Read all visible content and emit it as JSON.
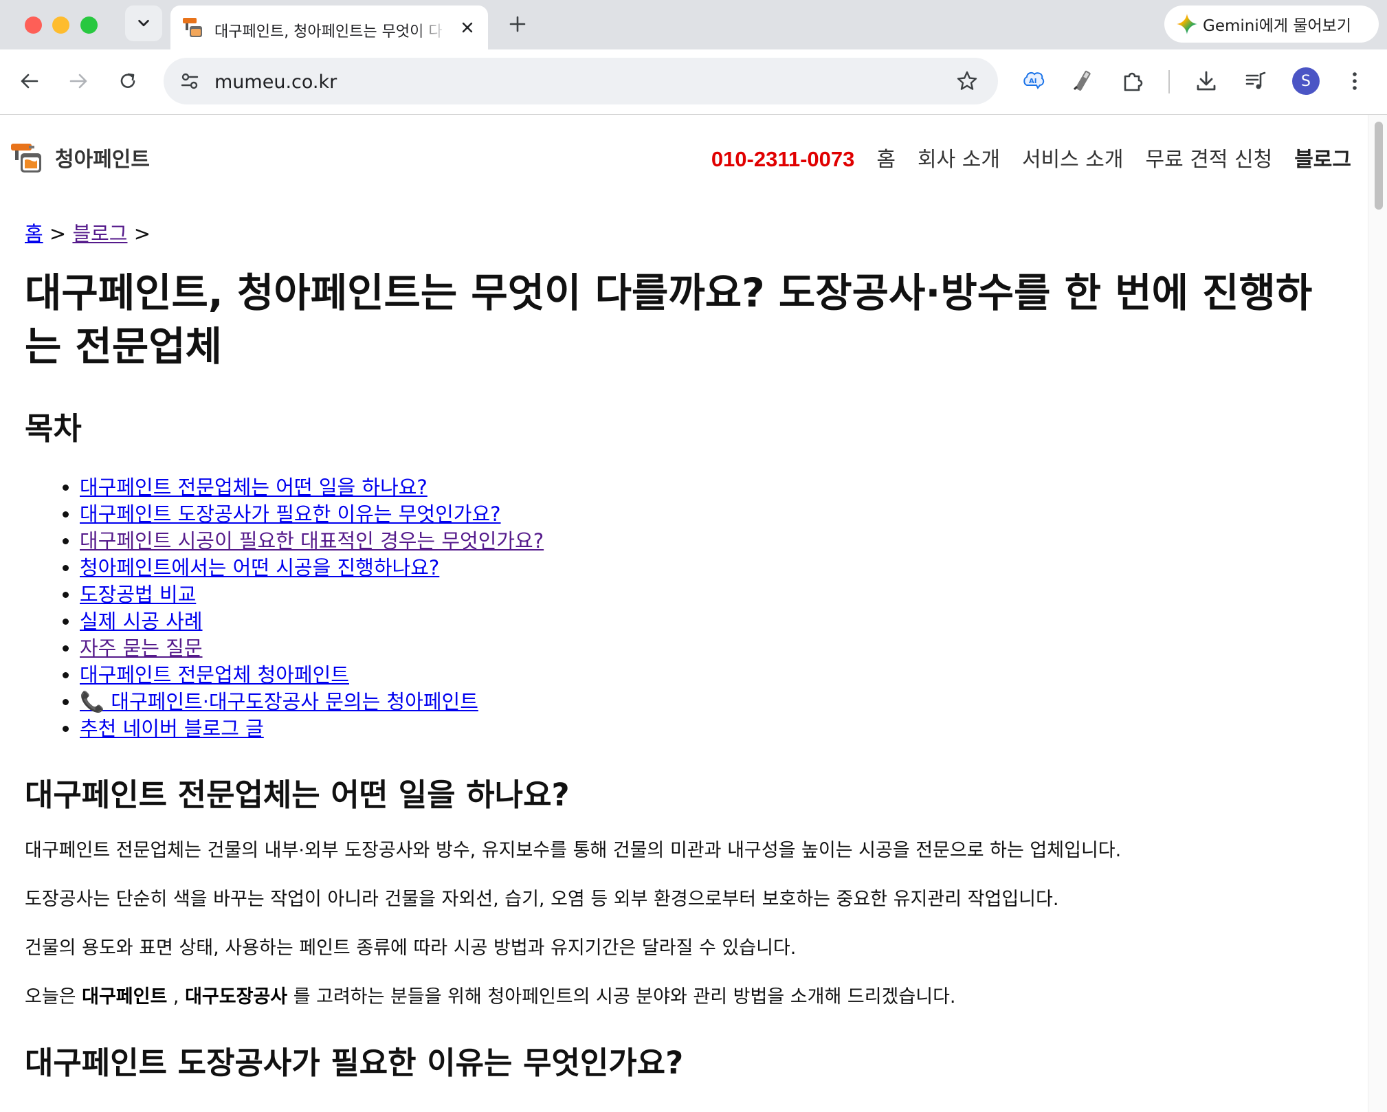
{
  "browser": {
    "tab": {
      "title": "대구페인트, 청아페인트는 무엇이 다"
    },
    "gemini_button": {
      "label": "Gemini에게 물어보기"
    },
    "address_bar": {
      "url": "mumeu.co.kr"
    },
    "profile": {
      "initial": "S"
    }
  },
  "site": {
    "name": "청아페인트",
    "phone": "010-2311-0073",
    "nav": [
      {
        "label": "홈"
      },
      {
        "label": "회사 소개"
      },
      {
        "label": "서비스 소개"
      },
      {
        "label": "무료 견적 신청"
      },
      {
        "label": "블로그"
      }
    ]
  },
  "breadcrumb": {
    "home": "홈",
    "sep1": ">",
    "blog": "블로그",
    "sep2": ">"
  },
  "article": {
    "title": "대구페인트, 청아페인트는 무엇이 다를까요? 도장공사·방수를 한 번에 진행하는 전문업체",
    "toc_title": "목차",
    "toc": [
      "대구페인트 전문업체는 어떤 일을 하나요?",
      "대구페인트 도장공사가 필요한 이유는 무엇인가요?",
      "대구페인트 시공이 필요한 대표적인 경우는 무엇인가요?",
      "청아페인트에서는 어떤 시공을 진행하나요?",
      "도장공법 비교",
      "실제 시공 사례",
      "자주 묻는 질문",
      "대구페인트 전문업체 청아페인트",
      "📞 대구페인트·대구도장공사 문의는 청아페인트",
      "추천 네이버 블로그 글"
    ],
    "section1": {
      "heading": "대구페인트 전문업체는 어떤 일을 하나요?",
      "p1": "대구페인트 전문업체는 건물의 내부·외부 도장공사와 방수, 유지보수를 통해 건물의 미관과 내구성을 높이는 시공을 전문으로 하는 업체입니다.",
      "p2": "도장공사는 단순히 색을 바꾸는 작업이 아니라 건물을 자외선, 습기, 오염 등 외부 환경으로부터 보호하는 중요한 유지관리 작업입니다.",
      "p3": "건물의 용도와 표면 상태, 사용하는 페인트 종류에 따라 시공 방법과 유지기간은 달라질 수 있습니다.",
      "p4_prefix": "오늘은 ",
      "p4_bold1": "대구페인트",
      "p4_mid": " , ",
      "p4_bold2": "대구도장공사",
      "p4_suffix": " 를 고려하는 분들을 위해 청아페인트의 시공 분야와 관리 방법을 소개해 드리겠습니다."
    },
    "section2": {
      "heading": "대구페인트 도장공사가 필요한 이유는 무엇인가요?"
    }
  }
}
